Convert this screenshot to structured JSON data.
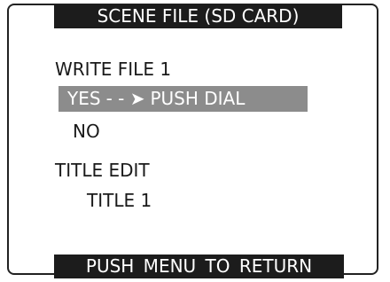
{
  "menu": {
    "title": "SCENE FILE (SD CARD)",
    "write_section": {
      "label": "WRITE FILE 1",
      "options": [
        {
          "label": "YES",
          "arrow": "- - ➤",
          "hint": "PUSH DIAL",
          "selected": true
        },
        {
          "label": "NO",
          "selected": false
        }
      ]
    },
    "title_section": {
      "label": "TITLE EDIT",
      "value": "TITLE 1"
    },
    "footer": "PUSH  MENU  TO  RETURN"
  },
  "colors": {
    "bar_background": "#1c1c1c",
    "highlight_background": "#8c8c8c",
    "text": "#1a1a1a",
    "inverse_text": "#ffffff"
  }
}
